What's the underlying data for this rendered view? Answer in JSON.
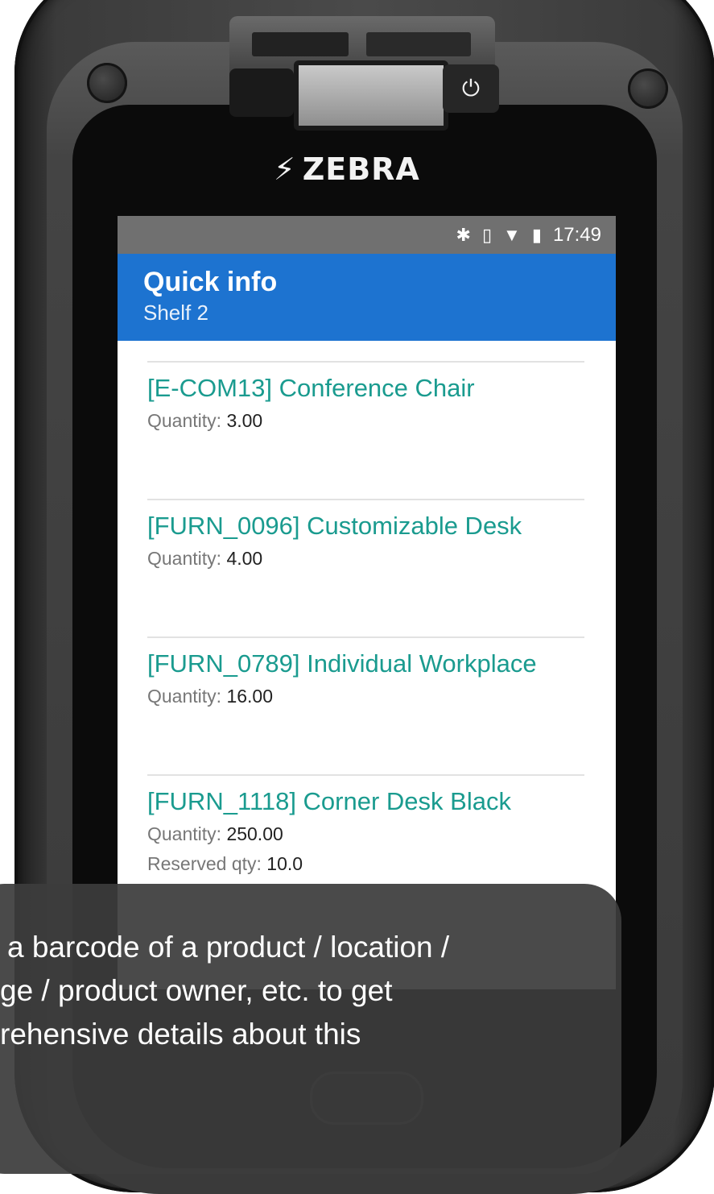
{
  "device": {
    "brand": "ZEBRA",
    "power_icon": "power-icon",
    "logo_icon": "zebra-logo-icon"
  },
  "status_bar": {
    "icons": [
      "bluetooth-icon",
      "vibrate-icon",
      "wifi-icon",
      "battery-icon"
    ],
    "time": "17:49"
  },
  "header": {
    "title": "Quick info",
    "subtitle": "Shelf 2"
  },
  "items": [
    {
      "name": "[E-COM13] Conference Chair",
      "quantity_label": "Quantity:",
      "quantity": "3.00"
    },
    {
      "name": "[FURN_0096] Customizable Desk",
      "quantity_label": "Quantity:",
      "quantity": "4.00"
    },
    {
      "name": "[FURN_0789] Individual Workplace",
      "quantity_label": "Quantity:",
      "quantity": "16.00"
    },
    {
      "name": "[FURN_1118] Corner Desk Black",
      "quantity_label": "Quantity:",
      "quantity": "250.00",
      "reserved_label": "Reserved qty:",
      "reserved": "10.0"
    }
  ],
  "tooltip": {
    "lines": [
      "a  barcode of a product / location /",
      "ge / product owner, etc. to get",
      "rehensive details about this"
    ]
  },
  "colors": {
    "header_bg": "#1d73d0",
    "status_bg": "#707070",
    "item_name": "#1a9b8f"
  }
}
